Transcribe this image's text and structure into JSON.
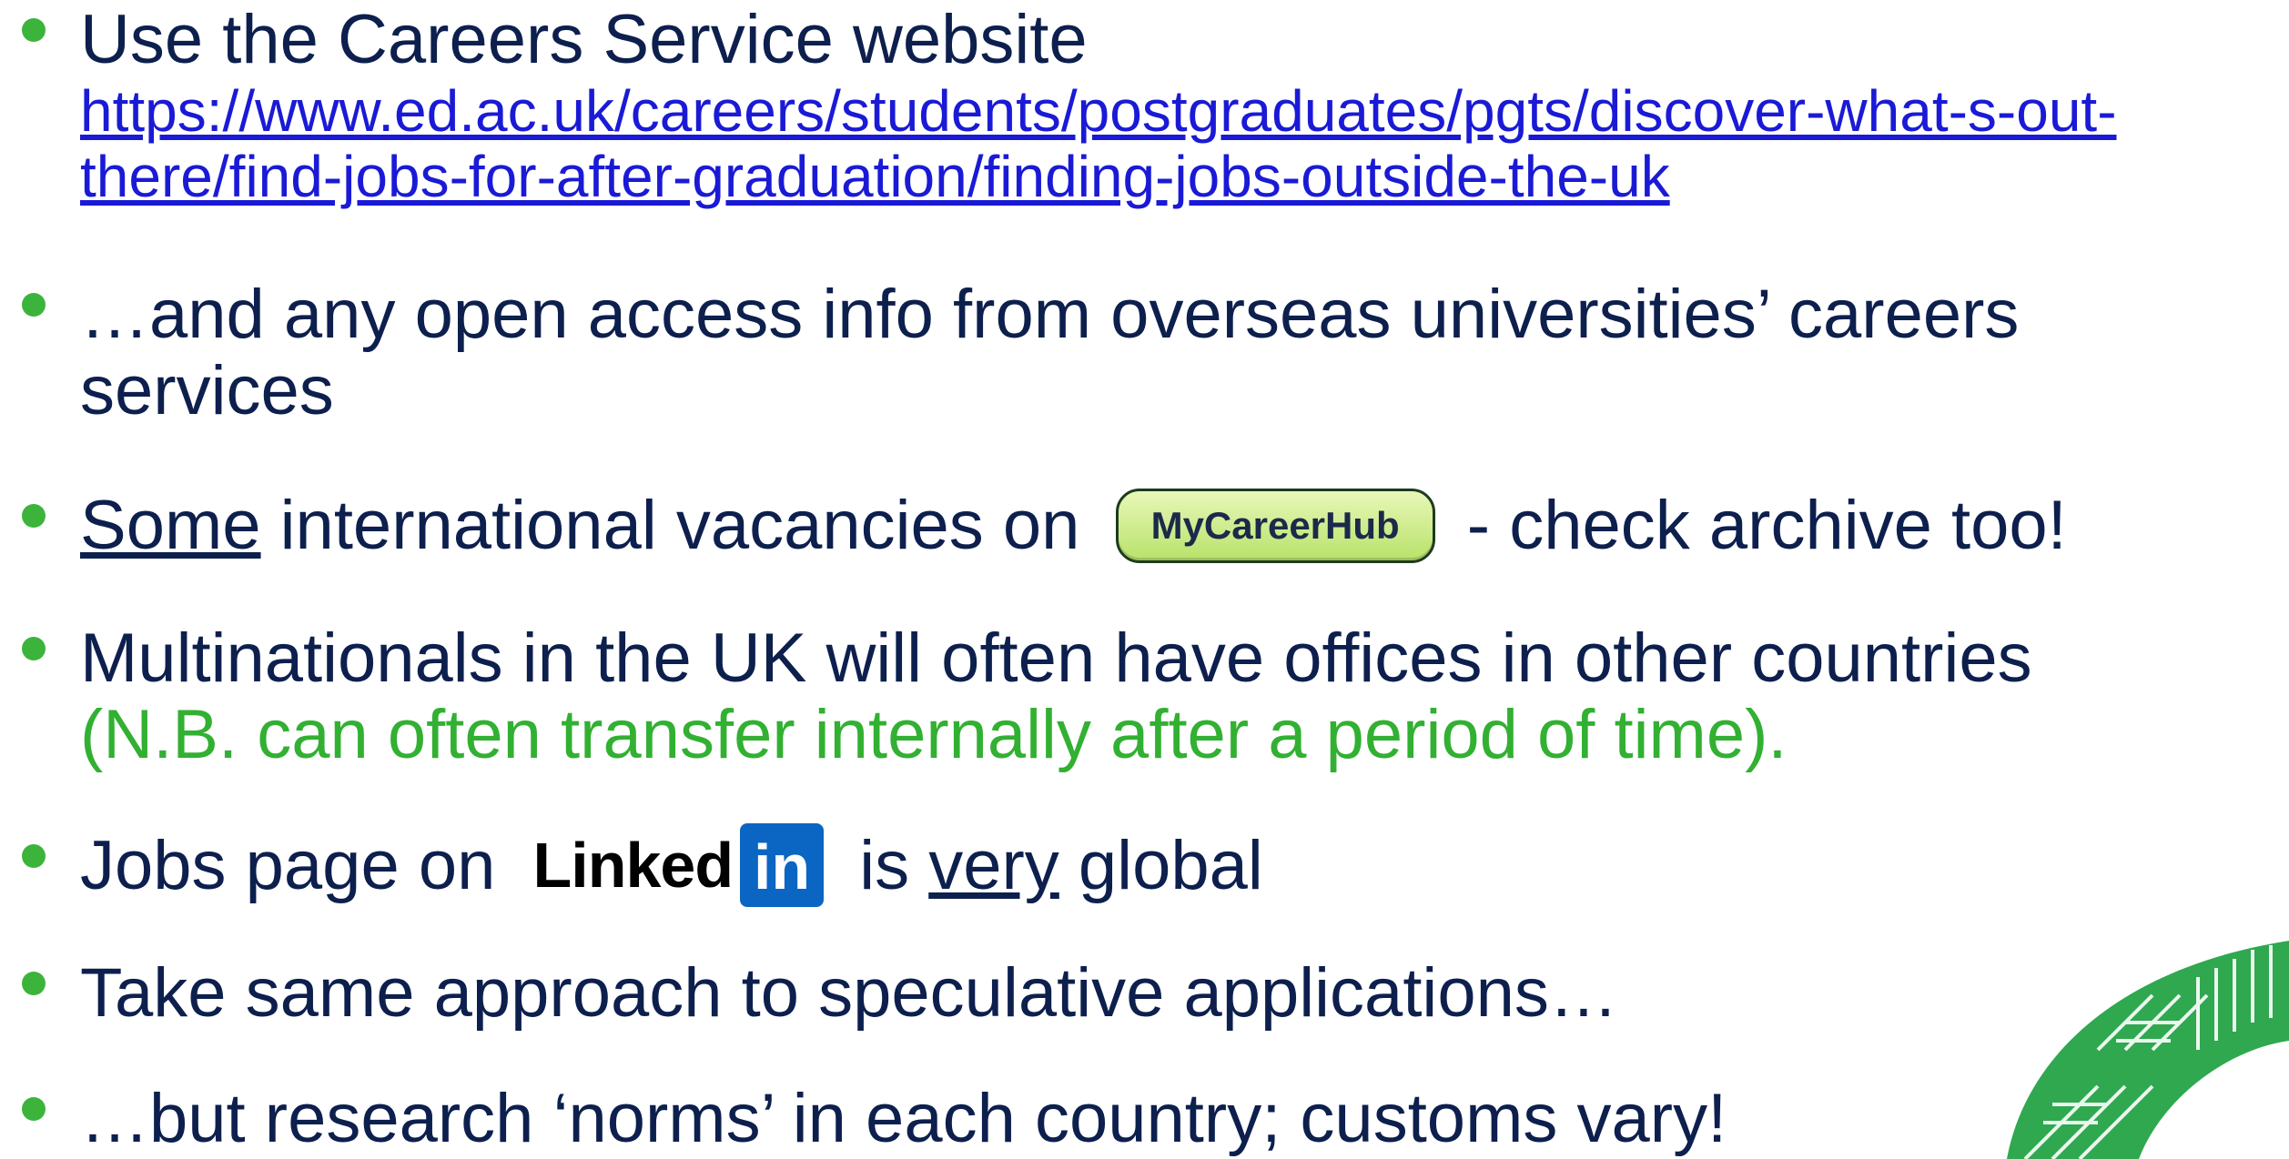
{
  "bullets": {
    "b1_text": "Use the Careers Service website",
    "b1_link": "https://www.ed.ac.uk/careers/students/postgraduates/pgts/discover-what-s-out-there/find-jobs-for-after-graduation/finding-jobs-outside-the-uk",
    "b2_text": "…and any open access info from overseas universities’ careers services",
    "b3_underlined": "Some",
    "b3_text_a": " international vacancies on ",
    "b3_button": "MyCareerHub",
    "b3_text_b": " - check archive too!",
    "b4_text": "Multinationals in the UK will often have offices in other countries",
    "b4_note": "(N.B. can often transfer internally after a period of time).",
    "b5_text_a": "Jobs page on ",
    "b5_logo_word": "Linked",
    "b5_logo_box": "in",
    "b5_text_b": " is ",
    "b5_underlined": "very",
    "b5_text_c": " global",
    "b6_text": "Take same approach to speculative applications…",
    "b7_text": "…but research ‘norms’ in each country; customs vary!"
  },
  "colors": {
    "text": "#0d1f4d",
    "bullet": "#3cb43c",
    "link": "#1a1ad6",
    "note": "#32b032",
    "linkedin": "#0a66c2"
  }
}
